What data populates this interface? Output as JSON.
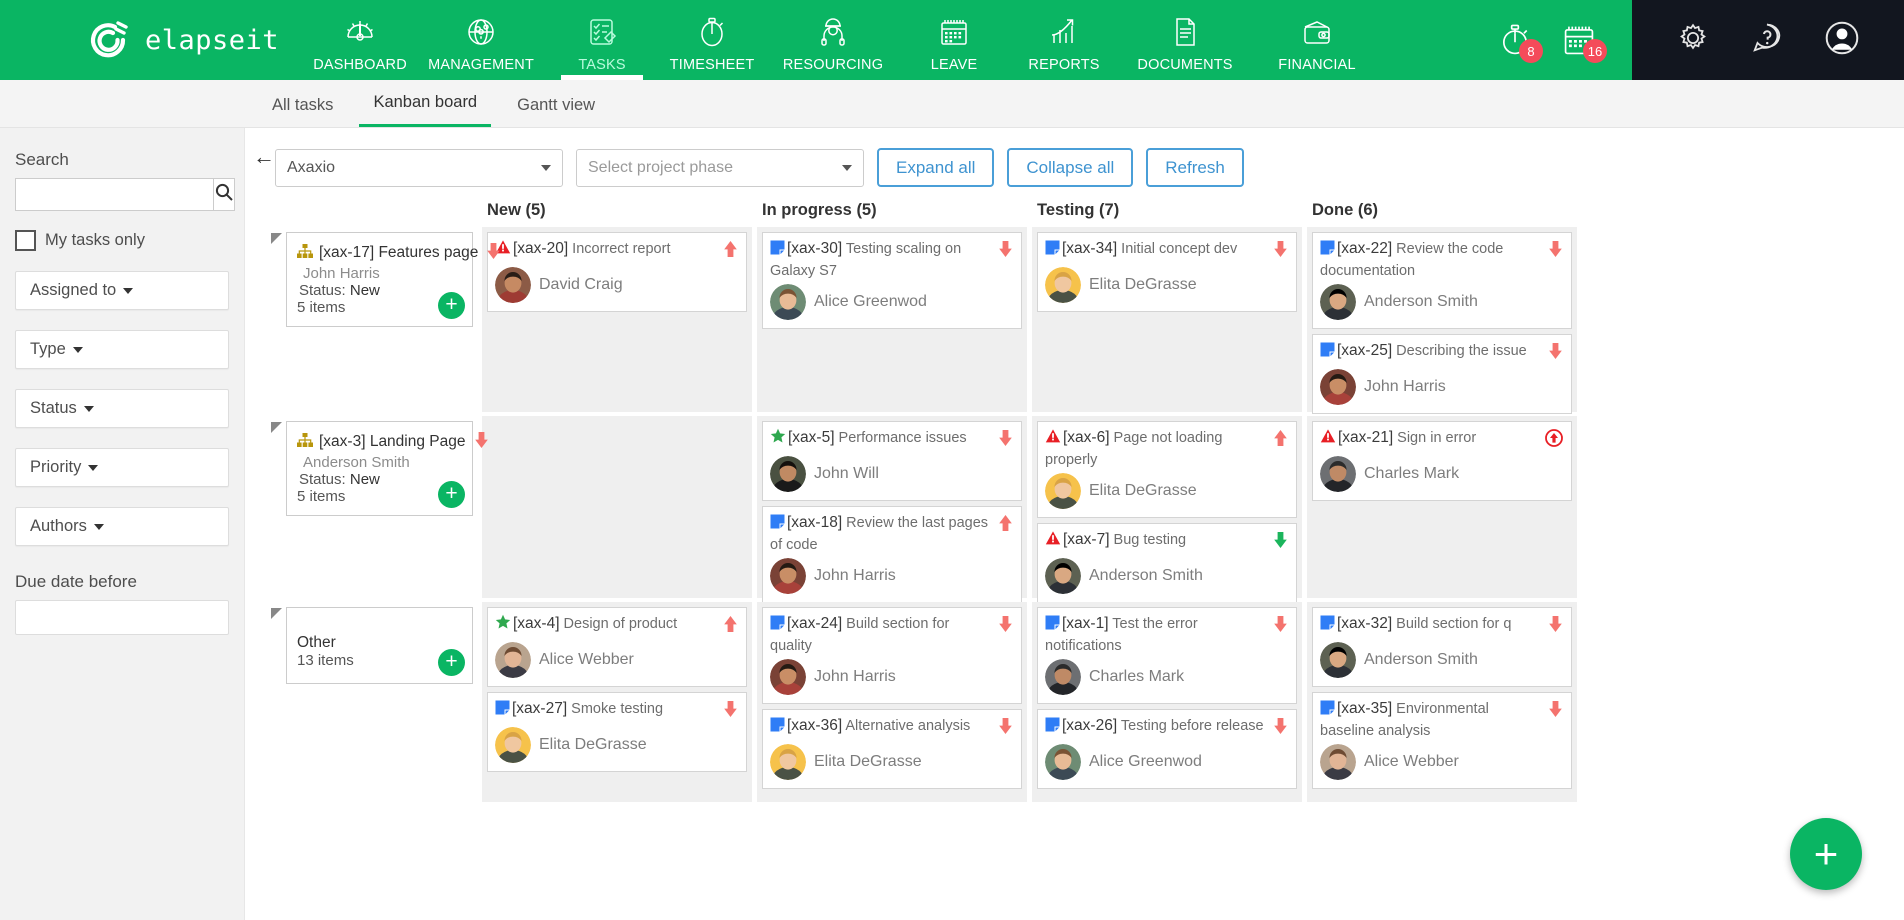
{
  "brand": {
    "name": "elapseit",
    "logo_icon": "elapseit-logo-icon"
  },
  "nav": {
    "items": [
      {
        "label": "DASHBOARD",
        "icon": "dashboard-gauge-icon",
        "active": false
      },
      {
        "label": "MANAGEMENT",
        "icon": "globe-icon",
        "active": false
      },
      {
        "label": "TASKS",
        "icon": "checklist-pencil-icon",
        "active": true
      },
      {
        "label": "TIMESHEET",
        "icon": "stopwatch-icon",
        "active": false
      },
      {
        "label": "RESOURCING",
        "icon": "worker-icon",
        "active": false
      },
      {
        "label": "LEAVE",
        "icon": "calendar-icon",
        "active": false
      },
      {
        "label": "REPORTS",
        "icon": "bar-chart-arrow-icon",
        "active": false
      },
      {
        "label": "DOCUMENTS",
        "icon": "document-icon",
        "active": false
      },
      {
        "label": "FINANCIAL",
        "icon": "wallet-icon",
        "active": false
      }
    ],
    "right": {
      "timer_badge": "8",
      "calendar_badge": "16",
      "timer_icon": "stopwatch-icon",
      "calendar_icon": "calendar-icon",
      "settings_icon": "gear-icon",
      "help_icon": "question-bubble-icon",
      "profile_icon": "user-avatar-icon"
    }
  },
  "tabs": [
    {
      "label": "All tasks",
      "active": false
    },
    {
      "label": "Kanban board",
      "active": true
    },
    {
      "label": "Gantt view",
      "active": false
    }
  ],
  "sidebar": {
    "search_label": "Search",
    "search_value": "",
    "search_placeholder": "",
    "search_icon": "search-icon",
    "my_tasks_label": "My tasks only",
    "my_tasks_checked": false,
    "filters": [
      {
        "label": "Assigned to"
      },
      {
        "label": "Type"
      },
      {
        "label": "Status"
      },
      {
        "label": "Priority"
      },
      {
        "label": "Authors"
      }
    ],
    "due_date_label": "Due date before",
    "due_date_value": "",
    "due_date_placeholder": "",
    "collapse_icon": "arrow-left-icon"
  },
  "toolbar": {
    "project_value": "Axaxio",
    "phase_placeholder": "Select project phase",
    "expand_all": "Expand all",
    "collapse_all": "Collapse all",
    "refresh": "Refresh"
  },
  "board": {
    "group_column": {
      "groups": [
        {
          "id": "[xax-17]",
          "title": "Features page",
          "owner": "John Harris",
          "status_label": "Status:",
          "status": "New",
          "items": "5 items",
          "type_icon": "sitemap-icon",
          "priority_icon": "arrow-down-low-icon",
          "add_icon": "plus-icon"
        },
        {
          "id": "[xax-3]",
          "title": "Landing Page",
          "owner": "Anderson Smith",
          "status_label": "Status:",
          "status": "New",
          "items": "5 items",
          "type_icon": "sitemap-icon",
          "priority_icon": "arrow-down-low-icon",
          "add_icon": "plus-icon"
        },
        {
          "id": "",
          "title": "Other",
          "owner": "",
          "status_label": "",
          "status": "",
          "items": "13 items",
          "type_icon": "",
          "priority_icon": "",
          "add_icon": "plus-icon"
        }
      ]
    },
    "columns": [
      {
        "title": "New (5)",
        "lanes": [
          [
            {
              "id": "[xax-20]",
              "title": "Incorrect report",
              "user": "David Craig",
              "type_icon": "bug-warning-icon",
              "priority_icon": "arrow-up-high-icon",
              "avatar": "av-david"
            }
          ],
          [],
          [
            {
              "id": "[xax-4]",
              "title": "Design of product",
              "user": "Alice Webber",
              "type_icon": "star-feature-icon",
              "priority_icon": "arrow-up-high-icon",
              "avatar": "av-alicew"
            },
            {
              "id": "[xax-27]",
              "title": "Smoke testing",
              "user": "Elita DeGrasse",
              "type_icon": "task-note-icon",
              "priority_icon": "arrow-down-low-icon",
              "avatar": "av-elita"
            }
          ]
        ]
      },
      {
        "title": "In progress (5)",
        "lanes": [
          [
            {
              "id": "[xax-30]",
              "title": "Testing scaling on Galaxy S7",
              "user": "Alice Greenwod",
              "type_icon": "task-note-icon",
              "priority_icon": "arrow-down-low-icon",
              "avatar": "av-aliceg"
            }
          ],
          [
            {
              "id": "[xax-5]",
              "title": "Performance issues",
              "user": "John Will",
              "type_icon": "star-feature-icon",
              "priority_icon": "arrow-down-low-icon",
              "avatar": "av-johnwill"
            },
            {
              "id": "[xax-18]",
              "title": "Review the last pages of code",
              "user": "John Harris",
              "type_icon": "task-note-icon",
              "priority_icon": "arrow-up-high-icon",
              "avatar": "av-johnh"
            }
          ],
          [
            {
              "id": "[xax-24]",
              "title": "Build section for quality",
              "user": "John Harris",
              "type_icon": "task-note-icon",
              "priority_icon": "arrow-down-low-icon",
              "avatar": "av-johnh"
            },
            {
              "id": "[xax-36]",
              "title": "Alternative analysis",
              "user": "Elita DeGrasse",
              "type_icon": "task-note-icon",
              "priority_icon": "arrow-down-low-icon",
              "avatar": "av-elita"
            }
          ]
        ]
      },
      {
        "title": "Testing (7)",
        "lanes": [
          [
            {
              "id": "[xax-34]",
              "title": "Initial concept dev",
              "user": "Elita DeGrasse",
              "type_icon": "task-note-icon",
              "priority_icon": "arrow-down-low-icon",
              "avatar": "av-elita"
            }
          ],
          [
            {
              "id": "[xax-6]",
              "title": "Page not loading properly",
              "user": "Elita DeGrasse",
              "type_icon": "bug-warning-icon",
              "priority_icon": "arrow-up-high-icon",
              "avatar": "av-elita"
            },
            {
              "id": "[xax-7]",
              "title": "Bug testing",
              "user": "Anderson Smith",
              "type_icon": "bug-warning-icon",
              "priority_icon": "arrow-down-green-icon",
              "avatar": "av-anderson"
            }
          ],
          [
            {
              "id": "[xax-1]",
              "title": "Test the error notifications",
              "user": "Charles Mark",
              "type_icon": "task-note-icon",
              "priority_icon": "arrow-down-low-icon",
              "avatar": "av-charles"
            },
            {
              "id": "[xax-26]",
              "title": "Testing before release",
              "user": "Alice Greenwod",
              "type_icon": "task-note-icon",
              "priority_icon": "arrow-down-low-icon",
              "avatar": "av-aliceg"
            }
          ]
        ]
      },
      {
        "title": "Done (6)",
        "lanes": [
          [
            {
              "id": "[xax-22]",
              "title": "Review the code documentation",
              "user": "Anderson Smith",
              "type_icon": "task-note-icon",
              "priority_icon": "arrow-down-low-icon",
              "avatar": "av-anderson"
            },
            {
              "id": "[xax-25]",
              "title": "Describing the issue",
              "user": "John Harris",
              "type_icon": "task-note-icon",
              "priority_icon": "arrow-down-low-icon",
              "avatar": "av-johnh"
            }
          ],
          [
            {
              "id": "[xax-21]",
              "title": "Sign in error",
              "user": "Charles Mark",
              "type_icon": "bug-warning-icon",
              "priority_icon": "critical-up-circle-icon",
              "avatar": "av-charles"
            }
          ],
          [
            {
              "id": "[xax-32]",
              "title": "Build section for q",
              "user": "Anderson Smith",
              "type_icon": "task-note-icon",
              "priority_icon": "arrow-down-low-icon",
              "avatar": "av-anderson"
            },
            {
              "id": "[xax-35]",
              "title": "Environmental baseline analysis",
              "user": "Alice Webber",
              "type_icon": "task-note-icon",
              "priority_icon": "arrow-down-low-icon",
              "avatar": "av-alicew"
            }
          ]
        ]
      }
    ]
  },
  "fab": {
    "label": "+",
    "icon": "plus-icon"
  },
  "colors": {
    "brand_green": "#0ab563",
    "dark_panel": "#12161f",
    "badge_red": "#f44b5a",
    "link_blue": "#3e93d0",
    "priority_down": "#f4736e",
    "priority_up": "#f4736e",
    "priority_green": "#2ecc71"
  }
}
